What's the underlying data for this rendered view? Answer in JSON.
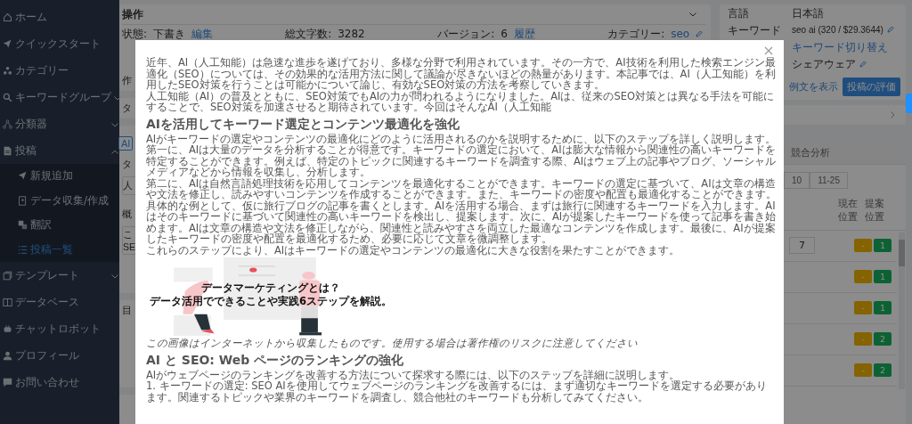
{
  "sidebar": {
    "items": [
      {
        "label": "ホーム",
        "selected": false
      },
      {
        "label": "クイックスタート",
        "selected": false
      },
      {
        "label": "カテゴリー",
        "selected": false
      },
      {
        "label": "キーワードグループ",
        "selected": false,
        "expanded": false
      },
      {
        "label": "分類器",
        "selected": false,
        "expanded": false
      },
      {
        "label": "投稿",
        "selected": false,
        "expanded": true,
        "children": [
          {
            "label": "新規追加",
            "selected": false
          },
          {
            "label": "データ収集/作成",
            "selected": false
          },
          {
            "label": "翻訳",
            "selected": false
          },
          {
            "label": "投稿一覧",
            "selected": true
          }
        ]
      },
      {
        "label": "テンプレート",
        "selected": false,
        "expanded": false
      },
      {
        "label": "データベース",
        "selected": false
      },
      {
        "label": "チャットロボット",
        "selected": false
      },
      {
        "label": "プロフィール",
        "selected": false
      },
      {
        "label": "お問い合わせ",
        "selected": false
      }
    ]
  },
  "operations_card": {
    "title": "操作",
    "status_label": "状態:",
    "status_value": "下書き",
    "edit_link": "編集",
    "char_count_label": "総文字数:",
    "char_count": "3282",
    "version_label": "バージョン:",
    "version": "6",
    "history_link": "履歴",
    "category_label": "カテゴリー:",
    "category": "seo",
    "created_label": "作"
  },
  "title_card": {
    "label": "タ"
  },
  "editor_card": {
    "tab": "AI",
    "title_label": "タ",
    "title_value": "人",
    "summary_label": "概",
    "summary_lines": [
      "こ",
      "SE"
    ]
  },
  "toc_card": {
    "label": "目"
  },
  "info_card": {
    "rows": [
      {
        "label": "言語",
        "value": "日本語"
      },
      {
        "label": "キーワード",
        "value": "seo ai (320 / $29.3644)"
      }
    ],
    "switch_link": "キーワード切り替え",
    "shareware": "シェアウェア",
    "example_link": "例文を表示",
    "evaluate_button": "投稿の評価"
  },
  "competitor_card": {
    "tab": "競合分析",
    "pages": [
      {
        "label": "10",
        "selected": false
      },
      {
        "label": "11-25",
        "selected": false
      }
    ],
    "columns": [
      "現在位置",
      "提案位置"
    ],
    "rows": [
      {
        "extra": "7",
        "current": "-",
        "proposed": "1"
      },
      {
        "current": "-",
        "proposed": "1"
      },
      {
        "current": "-",
        "proposed": "1"
      },
      {
        "current": "-",
        "proposed": "2"
      },
      {
        "current": "-",
        "proposed": "2"
      }
    ]
  },
  "modal": {
    "blocks": [
      {
        "kind": "paragraph",
        "lines": [
          "近年、AI（人工知能）は急速な進歩を遂げており、多様な分野で利用されています。その一方で、AI技術を利用した検索エンジン最適化（SEO）については、その効果的な活用方法に関して議論が尽きないほどの熱量があります。本記事では、AI（人工知能）を利用したSEO対策を行うことは可能かについて論じ、有効なSEO対策の方法を考察していきます。",
          "人工知能（AI）の普及とともに、SEO対策でもAIの力が問われるようになりました。AIは、従来のSEO対策とは異なる手法を可能にすることで、SEO対策を加速させると期待されています。今回はそんなAI（人工知能"
        ]
      },
      {
        "kind": "heading",
        "text": "AIを活用してキーワード選定とコンテンツ最適化を強化"
      },
      {
        "kind": "paragraph",
        "lines": [
          "AIがキーワードの選定やコンテンツの最適化にどのように活用されるのかを説明するために、以下のステップを詳しく説明します。",
          "第一に、AIは大量のデータを分析することが得意です。キーワードの選定において、AIは膨大な情報から関連性の高いキーワードを特定することができます。例えば、特定のトピックに関連するキーワードを調査する際、AIはウェブ上の記事やブログ、ソーシャルメディアなどから情報を収集し、分析します。",
          "第二に、AIは自然言語処理技術を応用してコンテンツを最適化することができます。キーワードの選定に基づいて、AIは文章の構造や文法を修正し、読みやすいコンテンツを作成することができます。また、キーワードの密度や配置も最適化することができます。",
          "具体的な例として、仮に旅行ブログの記事を書くとします。AIを活用する場合、まずは旅行に関連するキーワードを入力します。AIはそのキーワードに基づいて関連性の高いキーワードを検出し、提案します。次に、AIが提案したキーワードを使って記事を書き始めます。AIは文章の構造や文法を修正しながら、関連性と読みやすさを両立した最適なコンテンツを作成します。最後に、AIが提案したキーワードの密度や配置を最適化するため、必要に応じて文章を微調整します。",
          "これらのステップにより、AIはキーワードの選定やコンテンツの最適化に大きな役割を果たすことができます。"
        ]
      },
      {
        "kind": "image",
        "title_lines": [
          "データマーケティングとは？",
          "データ活用でできることや実践6ステップを解説。"
        ]
      },
      {
        "kind": "caption",
        "text": "この画像はインターネットから収集したものです。使用する場合は著作権のリスクに注意してください"
      },
      {
        "kind": "heading",
        "text": "AI と SEO: Web ページのランキングの強化"
      },
      {
        "kind": "paragraph",
        "lines": [
          "AIがウェブページのランキングを改善する方法について探求する際には、以下のステップを詳細に説明します。",
          "1. キーワードの選定: SEO AIを使用してウェブページのランキングを改善するには、まず適切なキーワードを選定する必要があります。関連するトピックや業界のキーワードを調査し、競合他社のキーワードも分析してみてください。"
        ]
      }
    ]
  }
}
